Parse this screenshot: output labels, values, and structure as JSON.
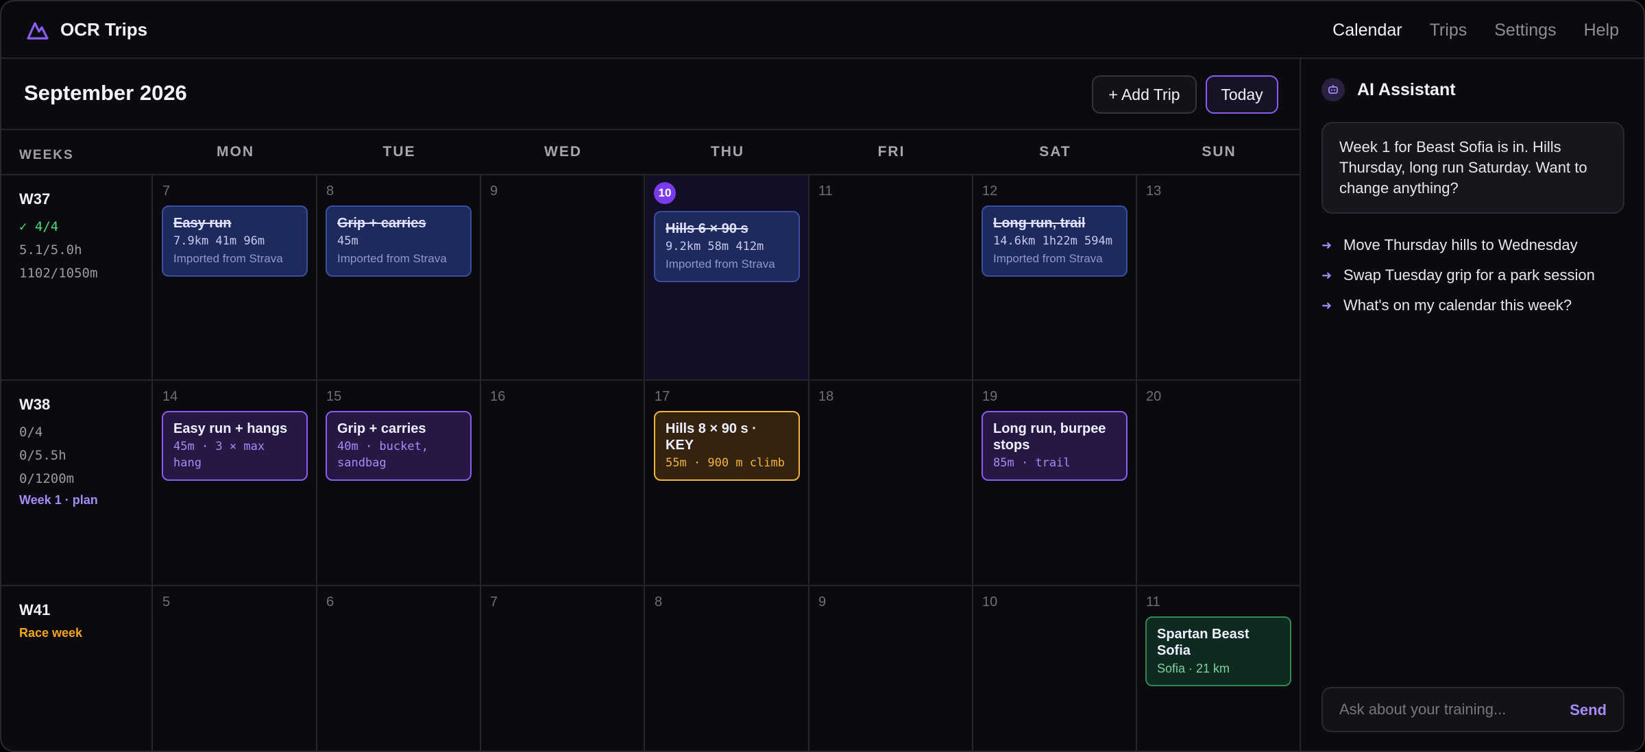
{
  "app": {
    "name": "OCR Trips",
    "logo_icon": "mountain-logo-icon"
  },
  "nav": {
    "items": [
      "Calendar",
      "Trips",
      "Settings",
      "Help"
    ],
    "active": "Calendar"
  },
  "calendar": {
    "month_title": "September 2026",
    "add_trip_label": "+ Add Trip",
    "today_label": "Today",
    "weeks_label": "WEEKS",
    "days_of_week": [
      "MON",
      "TUE",
      "WED",
      "THU",
      "FRI",
      "SAT",
      "SUN"
    ],
    "weeks": [
      {
        "label": "W37",
        "stats": [
          "✓ 4/4",
          "5.1/5.0h",
          "1102/1050m"
        ],
        "tag": "",
        "days": [
          {
            "num": "7",
            "events": [
              {
                "title": "Easy run",
                "meta": "7.9km 41m 96m",
                "note": "Imported from Strava",
                "status": "done"
              }
            ]
          },
          {
            "num": "8",
            "events": [
              {
                "title": "Grip + carries",
                "meta": "45m",
                "note": "Imported from Strava",
                "status": "done"
              }
            ]
          },
          {
            "num": "9",
            "events": []
          },
          {
            "num": "10",
            "today": true,
            "events": [
              {
                "title": "Hills 6 × 90 s",
                "meta": "9.2km 58m 412m",
                "note": "Imported from Strava",
                "status": "done"
              }
            ]
          },
          {
            "num": "11",
            "events": []
          },
          {
            "num": "12",
            "events": [
              {
                "title": "Long run, trail",
                "meta": "14.6km 1h22m 594m",
                "note": "Imported from Strava",
                "status": "done"
              }
            ]
          },
          {
            "num": "13",
            "events": []
          }
        ]
      },
      {
        "label": "W38",
        "stats": [
          "0/4",
          "0/5.5h",
          "0/1200m"
        ],
        "tag": "Week 1 · plan",
        "days": [
          {
            "num": "14",
            "events": [
              {
                "title": "Easy run + hangs",
                "meta": "45m · 3 × max hang",
                "status": "plan"
              }
            ]
          },
          {
            "num": "15",
            "events": [
              {
                "title": "Grip + carries",
                "meta": "40m · bucket, sandbag",
                "status": "plan"
              }
            ]
          },
          {
            "num": "16",
            "events": []
          },
          {
            "num": "17",
            "events": [
              {
                "title": "Hills 8 × 90 s · KEY",
                "meta": "55m · 900 m climb",
                "status": "key"
              }
            ]
          },
          {
            "num": "18",
            "events": []
          },
          {
            "num": "19",
            "events": [
              {
                "title": "Long run, burpee stops",
                "meta": "85m · trail",
                "status": "plan"
              }
            ]
          },
          {
            "num": "20",
            "events": []
          }
        ]
      },
      {
        "label": "W41",
        "stats": [],
        "tag": "Race week",
        "days": [
          {
            "num": "5",
            "events": []
          },
          {
            "num": "6",
            "events": []
          },
          {
            "num": "7",
            "events": []
          },
          {
            "num": "8",
            "events": []
          },
          {
            "num": "9",
            "events": []
          },
          {
            "num": "10",
            "events": []
          },
          {
            "num": "11",
            "events": [
              {
                "title": "Spartan Beast Sofia",
                "note": "Sofia · 21 km",
                "status": "race"
              }
            ]
          }
        ]
      }
    ]
  },
  "assistant": {
    "title": "AI Assistant",
    "icon": "robot-icon",
    "message": "Week 1 for Beast Sofia is in. Hills Thursday, long run Saturday. Want to change anything?",
    "suggestions": [
      "Move Thursday hills to Wednesday",
      "Swap Tuesday grip for a park session",
      "What's on my calendar this week?"
    ],
    "input_placeholder": "Ask about your training...",
    "send_label": "Send"
  },
  "colors": {
    "accent": "#8b5cf6",
    "done": "#1e2a5c",
    "key": "#f5b342",
    "race": "#2f8a5a",
    "success": "#4ade80"
  }
}
